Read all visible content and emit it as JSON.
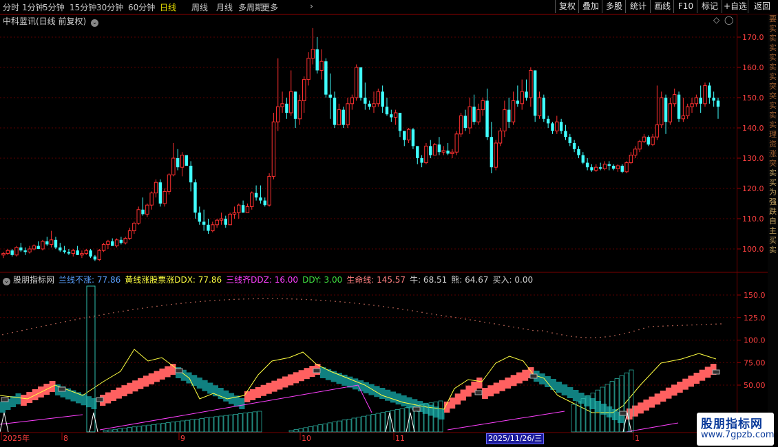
{
  "toolbar": {
    "timeframes": [
      "分时",
      "1分钟",
      "5分钟",
      "15分钟",
      "30分钟",
      "60分钟",
      "日线",
      "周线",
      "月线",
      "多周期",
      "更多"
    ],
    "active": "日线",
    "right_buttons": [
      "复权",
      "叠加",
      "多股",
      "统计",
      "画线",
      "F10",
      "标记",
      "+自选",
      "返回"
    ]
  },
  "main_header": {
    "title": "中科蓝讯(日线 前复权)"
  },
  "indicator_header": {
    "name": "股朋指标网",
    "items": [
      {
        "label": "兰线不涨: 77.86",
        "color": "#5aa0ff"
      },
      {
        "label": "黄线涨股票涨DDX: 77.86",
        "color": "#ffff40"
      },
      {
        "label": "三线齐DDZ: 16.00",
        "color": "#ff40ff"
      },
      {
        "label": "DDY: 3.00",
        "color": "#40e040"
      },
      {
        "label": "生命线: 145.57",
        "color": "#ff8080"
      },
      {
        "label": "牛: 68.51",
        "color": "#d0d0d0"
      },
      {
        "label": "熊: 64.67",
        "color": "#d0d0d0"
      },
      {
        "label": "买入: 0.00",
        "color": "#d0d0d0"
      }
    ]
  },
  "price_axis": [
    "170.0",
    "160.0",
    "150.0",
    "140.0",
    "130.0",
    "120.0",
    "110.0",
    "100.0"
  ],
  "indicator_axis": [
    "150.0",
    "125.0",
    "100.0",
    "75.00",
    "50.00"
  ],
  "date_axis": [
    "2025年",
    "8",
    "9",
    "10",
    "11",
    "1"
  ],
  "cursor_date": "2025/11/26/三",
  "side_text": [
    "要",
    "实",
    "实",
    "实",
    "实",
    "实",
    "实",
    "突",
    "突",
    "实",
    "实",
    "实",
    "理",
    "资",
    "涨",
    "突",
    "实",
    "买",
    "为",
    "强",
    "跌",
    "自",
    "主",
    "买",
    "实"
  ],
  "watermark": {
    "line1": "股朋指标网",
    "line2": "www.7gpzb.com"
  },
  "chart_data": {
    "type": "candlestick",
    "title": "中科蓝讯(日线 前复权)",
    "ylim": [
      95,
      175
    ],
    "up_color": "#ff3030",
    "down_color": "#40ffff",
    "candles": [
      [
        98,
        99,
        97,
        98.5
      ],
      [
        98.5,
        100,
        98,
        99.5
      ],
      [
        99.5,
        100,
        97.5,
        98
      ],
      [
        98,
        101,
        97.5,
        100.5
      ],
      [
        100.5,
        102,
        99,
        99.5
      ],
      [
        99.5,
        100.5,
        98,
        99
      ],
      [
        99,
        101,
        98.5,
        100
      ],
      [
        100,
        101.5,
        99.5,
        101
      ],
      [
        101,
        102.5,
        100,
        100
      ],
      [
        100,
        103,
        99.5,
        102.5
      ],
      [
        102.5,
        104,
        101,
        101.5
      ],
      [
        101.5,
        106,
        100.5,
        103
      ],
      [
        103,
        104,
        100,
        100.5
      ],
      [
        100.5,
        102,
        99,
        99.5
      ],
      [
        99.5,
        101,
        98.5,
        99
      ],
      [
        99,
        100,
        98,
        98.5
      ],
      [
        98.5,
        100,
        97.5,
        99.5
      ],
      [
        99.5,
        101,
        98,
        98
      ],
      [
        98,
        99.5,
        97,
        98.5
      ],
      [
        98.5,
        100,
        98,
        99.5
      ],
      [
        99.5,
        100,
        97,
        97.5
      ],
      [
        97.5,
        98,
        96,
        96.5
      ],
      [
        96.5,
        100,
        96,
        99.5
      ],
      [
        99.5,
        102,
        99,
        101.5
      ],
      [
        101.5,
        103,
        100,
        102.5
      ],
      [
        102.5,
        103.5,
        101,
        101
      ],
      [
        101,
        103.5,
        100.5,
        103
      ],
      [
        103,
        104,
        101.5,
        102
      ],
      [
        102,
        104,
        101.5,
        103.5
      ],
      [
        103.5,
        107,
        103,
        106
      ],
      [
        106,
        109,
        105,
        108.5
      ],
      [
        108.5,
        114,
        108,
        113
      ],
      [
        113,
        117,
        111,
        111.5
      ],
      [
        111.5,
        115,
        110.5,
        114.5
      ],
      [
        114.5,
        119,
        113,
        118.5
      ],
      [
        118.5,
        123,
        117,
        122
      ],
      [
        122,
        123,
        114,
        115
      ],
      [
        115,
        120,
        114,
        119
      ],
      [
        119,
        125,
        118,
        124.5
      ],
      [
        124.5,
        135,
        124,
        130
      ],
      [
        130,
        133,
        126,
        127
      ],
      [
        127,
        132,
        124,
        131
      ],
      [
        131,
        130.5,
        128,
        127.5
      ],
      [
        127.5,
        129,
        119,
        122
      ],
      [
        122,
        123,
        110,
        112
      ],
      [
        112,
        114,
        108,
        109
      ],
      [
        109,
        113,
        106,
        108
      ],
      [
        108,
        110,
        105,
        106
      ],
      [
        106,
        109,
        105.5,
        108
      ],
      [
        108,
        110,
        107,
        109.5
      ],
      [
        109.5,
        112,
        108,
        110
      ],
      [
        110,
        111,
        107,
        108
      ],
      [
        108,
        112,
        108,
        111.5
      ],
      [
        111.5,
        114,
        110,
        112
      ],
      [
        112,
        115,
        110,
        114.5
      ],
      [
        114.5,
        116,
        112,
        112
      ],
      [
        112,
        115,
        112,
        114
      ],
      [
        114,
        119,
        113,
        118.5
      ],
      [
        118.5,
        121,
        116,
        117
      ],
      [
        117,
        121,
        115,
        116
      ],
      [
        116,
        117,
        114,
        114.5
      ],
      [
        114.5,
        125,
        114,
        124
      ],
      [
        124,
        145,
        123,
        142
      ],
      [
        142,
        163,
        139,
        147
      ],
      [
        147,
        152,
        145,
        148
      ],
      [
        148,
        150,
        143,
        145
      ],
      [
        145,
        159,
        144,
        152
      ],
      [
        152,
        152,
        140,
        143
      ],
      [
        143,
        151,
        141,
        149
      ],
      [
        149,
        157,
        145,
        156
      ],
      [
        156,
        165,
        154,
        163
      ],
      [
        163,
        173,
        161,
        166
      ],
      [
        166,
        170,
        158,
        159
      ],
      [
        159,
        166,
        156,
        162
      ],
      [
        162,
        163,
        150,
        151
      ],
      [
        151,
        158,
        143,
        150
      ],
      [
        150,
        152,
        140,
        141
      ],
      [
        141,
        148,
        141,
        146
      ],
      [
        146,
        147,
        140,
        141
      ],
      [
        141,
        150,
        140,
        148
      ],
      [
        148,
        151,
        146,
        150
      ],
      [
        150,
        161,
        149,
        160
      ],
      [
        160,
        160,
        149,
        150
      ],
      [
        150,
        155,
        146,
        148
      ],
      [
        148,
        149,
        146,
        147
      ],
      [
        147,
        152,
        145,
        148
      ],
      [
        148,
        153,
        147,
        152
      ],
      [
        152,
        154,
        145,
        147
      ],
      [
        147,
        150,
        144,
        144.5
      ],
      [
        144.5,
        146,
        142,
        143.5
      ],
      [
        143.5,
        146,
        141,
        145
      ],
      [
        145,
        145,
        137,
        139
      ],
      [
        139,
        139,
        134,
        136
      ],
      [
        136,
        140,
        135,
        139.5
      ],
      [
        139.5,
        140,
        133,
        134
      ],
      [
        134,
        134,
        128,
        130
      ],
      [
        130,
        131,
        127,
        128.5
      ],
      [
        128.5,
        135,
        128,
        134
      ],
      [
        134,
        136,
        130,
        131
      ],
      [
        131,
        135,
        131,
        134.5
      ],
      [
        134.5,
        137,
        131,
        132
      ],
      [
        132,
        134,
        131,
        132.5
      ],
      [
        132.5,
        135,
        131,
        131.5
      ],
      [
        131.5,
        133,
        130,
        132
      ],
      [
        132,
        139,
        131,
        138
      ],
      [
        138,
        145,
        137,
        144
      ],
      [
        144,
        146,
        139,
        140
      ],
      [
        140,
        150,
        138,
        147
      ],
      [
        147,
        151,
        141,
        142
      ],
      [
        142,
        148,
        141,
        146
      ],
      [
        146,
        150,
        144,
        149
      ],
      [
        149,
        153,
        136,
        137
      ],
      [
        137,
        142,
        125,
        127
      ],
      [
        127,
        136,
        126,
        135
      ],
      [
        135,
        140,
        134,
        139
      ],
      [
        139,
        149,
        137,
        146
      ],
      [
        146,
        150,
        140,
        142
      ],
      [
        142,
        152,
        141,
        149
      ],
      [
        149,
        154,
        147,
        148
      ],
      [
        148,
        156,
        146,
        152
      ],
      [
        152,
        156,
        149,
        150
      ],
      [
        150,
        160,
        147,
        159
      ],
      [
        159,
        159,
        142,
        144
      ],
      [
        144,
        152,
        143,
        150
      ],
      [
        150,
        151,
        142,
        143
      ],
      [
        143,
        144,
        140,
        141.5
      ],
      [
        141.5,
        142,
        138,
        139
      ],
      [
        139,
        144,
        138,
        142
      ],
      [
        142,
        143,
        138,
        139
      ],
      [
        139,
        141,
        136,
        137
      ],
      [
        137,
        138,
        134,
        135
      ],
      [
        135,
        136,
        132,
        133
      ],
      [
        133,
        134,
        130,
        131
      ],
      [
        131,
        132,
        128,
        128.5
      ],
      [
        128.5,
        130,
        126,
        127
      ],
      [
        127,
        128,
        125.5,
        126
      ],
      [
        126,
        128,
        125.5,
        127
      ],
      [
        127,
        128.5,
        126,
        126.5
      ],
      [
        126.5,
        129,
        126,
        128
      ],
      [
        128,
        129,
        126,
        127.5
      ],
      [
        127.5,
        128,
        126,
        126.5
      ],
      [
        126.5,
        128,
        125.5,
        127.5
      ],
      [
        127.5,
        128,
        125,
        125.5
      ],
      [
        125.5,
        129,
        125,
        128.5
      ],
      [
        128.5,
        132,
        128,
        131
      ],
      [
        131,
        134,
        130,
        133
      ],
      [
        133,
        136,
        132,
        135.5
      ],
      [
        135.5,
        138,
        135,
        137
      ],
      [
        137,
        137.5,
        134,
        134.5
      ],
      [
        134.5,
        138,
        134,
        137
      ],
      [
        137,
        154,
        136,
        141
      ],
      [
        141,
        152,
        140,
        150
      ],
      [
        150,
        151,
        138,
        142
      ],
      [
        142,
        150,
        141,
        148
      ],
      [
        148,
        153,
        147,
        151
      ],
      [
        151,
        152,
        142,
        143
      ],
      [
        143,
        150,
        142,
        144
      ],
      [
        144,
        148,
        143,
        147
      ],
      [
        147,
        150,
        145,
        148
      ],
      [
        148,
        151,
        147,
        150
      ],
      [
        150,
        154,
        145,
        148
      ],
      [
        148,
        155,
        147,
        154
      ],
      [
        154,
        155,
        148,
        150
      ],
      [
        150,
        152,
        147,
        149
      ],
      [
        149,
        150,
        143,
        147
      ]
    ]
  }
}
